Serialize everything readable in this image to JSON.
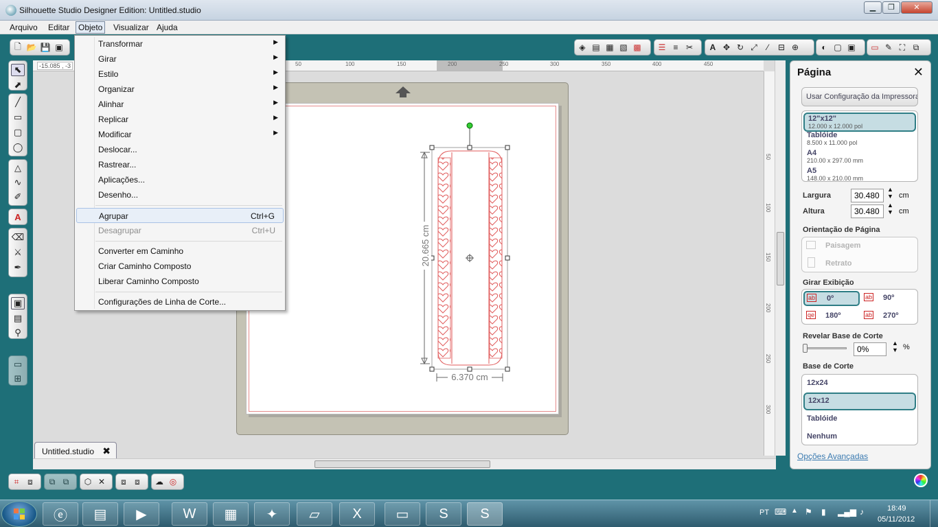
{
  "window": {
    "title": "Silhouette Studio Designer Edition: Untitled.studio",
    "minimize": "▁",
    "maximize": "❐",
    "close": "✕"
  },
  "menubar": [
    "Arquivo",
    "Editar",
    "Objeto",
    "Visualizar",
    "Ajuda"
  ],
  "dropdown": {
    "items": [
      {
        "label": "Transformar",
        "submenu": true
      },
      {
        "label": "Girar",
        "submenu": true
      },
      {
        "label": "Estilo",
        "submenu": true
      },
      {
        "label": "Organizar",
        "submenu": true
      },
      {
        "label": "Alinhar",
        "submenu": true
      },
      {
        "label": "Replicar",
        "submenu": true
      },
      {
        "label": "Modificar",
        "submenu": true
      },
      {
        "label": "Deslocar..."
      },
      {
        "label": "Rastrear..."
      },
      {
        "label": "Aplicações..."
      },
      {
        "label": "Desenho..."
      },
      {
        "label": "Agrupar",
        "shortcut": "Ctrl+G",
        "highlighted": true
      },
      {
        "label": "Desagrupar",
        "shortcut": "Ctrl+U",
        "disabled": true
      },
      {
        "label": "Converter em Caminho"
      },
      {
        "label": "Criar Caminho Composto"
      },
      {
        "label": "Liberar Caminho Composto"
      },
      {
        "label": "Configurações de Linha de Corte..."
      }
    ],
    "arrow": "▶"
  },
  "ruler": {
    "readout": "-15.085 , -3",
    "h_ticks": [
      "50",
      "100",
      "150",
      "200",
      "250",
      "300",
      "350",
      "400",
      "450"
    ],
    "v_ticks": [
      "50",
      "100",
      "150",
      "200",
      "250",
      "300"
    ]
  },
  "canvas": {
    "height_label": "20.665 cm",
    "width_label": "6.370 cm"
  },
  "document_tab": {
    "label": "Untitled.studio",
    "close": "✖"
  },
  "panel": {
    "title": "Página",
    "close": "✕",
    "printer_btn": "Usar Configuração da Impressora",
    "page_sizes": [
      {
        "name": "12\"x12\"",
        "dims": "12.000 x 12.000 pol",
        "selected": true
      },
      {
        "name": "Tablóide",
        "dims": "8.500 x 11.000 pol"
      },
      {
        "name": "A4",
        "dims": "210.00 x 297.00 mm"
      },
      {
        "name": "A5",
        "dims": "148.00 x 210.00 mm"
      }
    ],
    "width_label": "Largura",
    "width_value": "30.480",
    "height_label": "Altura",
    "height_value": "30.480",
    "unit": "cm",
    "orientation_label": "Orientação de Página",
    "orientation_options": [
      "Paisagem",
      "Retrato"
    ],
    "rotate_label": "Girar Exibição",
    "rotate_options": [
      "0º",
      "90º",
      "180º",
      "270º"
    ],
    "reveal_label": "Revelar Base de Corte",
    "reveal_value": "0%",
    "reveal_unit": "%",
    "mat_label": "Base de Corte",
    "mat_options": [
      "12x24",
      "12x12",
      "Tablóide",
      "Nenhum"
    ],
    "mat_selected": "12x12",
    "advanced_link": "Opções Avançadas"
  },
  "taskbar": {
    "lang": "PT",
    "time": "18:49",
    "date": "05/11/2012"
  },
  "colors": {
    "teal": "#1e6f78",
    "accent": "#2e7d85",
    "cut_red": "#e05a5a"
  }
}
